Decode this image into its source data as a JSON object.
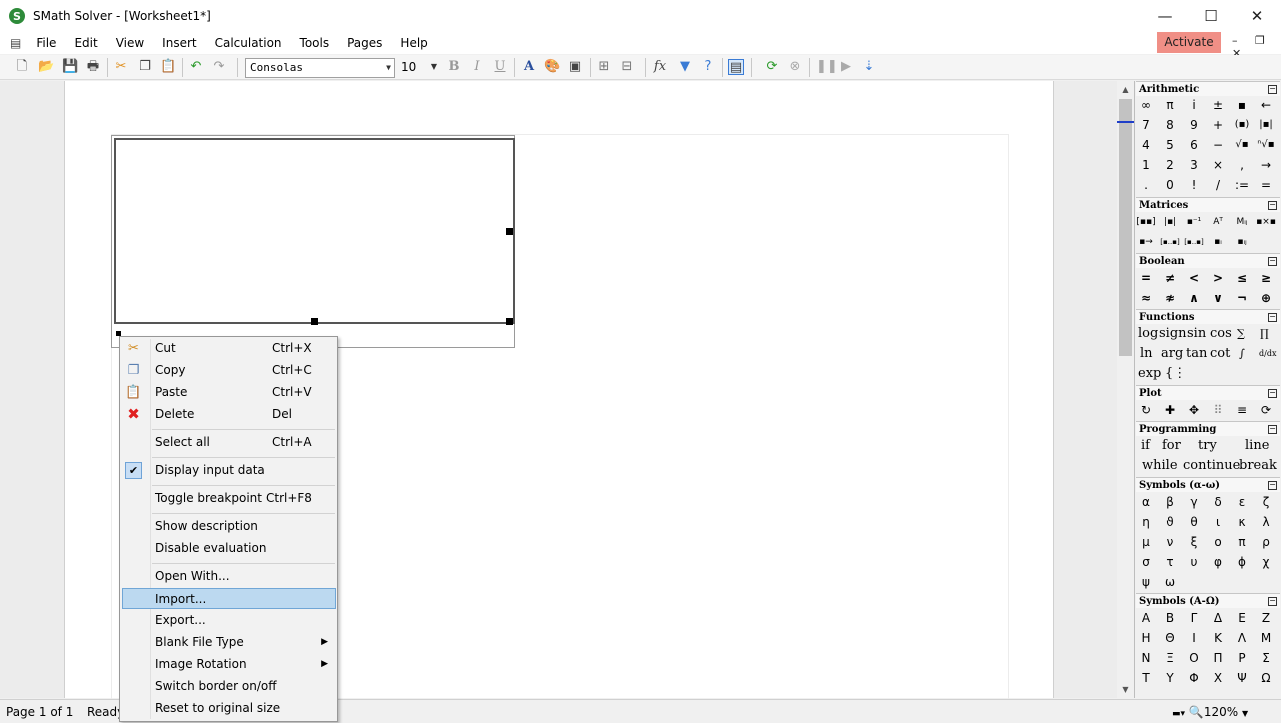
{
  "app": {
    "logo_letter": "S",
    "window_title": "SMath Solver - [Worksheet1*]",
    "window_controls": {
      "minimize": "—",
      "maximize": "☐",
      "close": "✕"
    },
    "activate_label": "Activate",
    "doc_controls": "– ❐ ✕"
  },
  "menubar": {
    "items": [
      "File",
      "Edit",
      "View",
      "Insert",
      "Calculation",
      "Tools",
      "Pages",
      "Help"
    ]
  },
  "toolbar": {
    "font_name": "Consolas",
    "font_size": "10",
    "fx_label": "fx"
  },
  "context_menu": {
    "items": [
      {
        "label": "Cut",
        "shortcut": "Ctrl+X",
        "icon": "scissors-icon"
      },
      {
        "label": "Copy",
        "shortcut": "Ctrl+C",
        "icon": "copy-icon"
      },
      {
        "label": "Paste",
        "shortcut": "Ctrl+V",
        "icon": "paste-icon"
      },
      {
        "label": "Delete",
        "shortcut": "Del",
        "icon": "delete-icon"
      },
      {
        "label": "Select all",
        "shortcut": "Ctrl+A"
      },
      {
        "label": "Display input data",
        "checked": true
      },
      {
        "label": "Toggle breakpoint",
        "shortcut": "Ctrl+F8"
      },
      {
        "label": "Show description"
      },
      {
        "label": "Disable evaluation"
      },
      {
        "label": "Open With..."
      },
      {
        "label": "Import...",
        "highlighted": true
      },
      {
        "label": "Export..."
      },
      {
        "label": "Blank File Type",
        "submenu": true
      },
      {
        "label": "Image Rotation",
        "submenu": true
      },
      {
        "label": "Switch border on/off"
      },
      {
        "label": "Reset to original size"
      }
    ]
  },
  "panels": {
    "arithmetic": {
      "title": "Arithmetic",
      "rows": [
        [
          "∞",
          "π",
          "i",
          "±",
          "▪",
          "←"
        ],
        [
          "7",
          "8",
          "9",
          "+",
          "(▪)",
          "|▪|"
        ],
        [
          "4",
          "5",
          "6",
          "−",
          "√▪",
          "ⁿ√▪"
        ],
        [
          "1",
          "2",
          "3",
          "×",
          ",",
          "→"
        ],
        [
          ".",
          "0",
          "!",
          "/",
          ":=",
          "="
        ]
      ]
    },
    "matrices": {
      "title": "Matrices",
      "rows": [
        [
          "[▪▪]",
          "|▪|",
          "▪⁻¹",
          "Aᵀ",
          "Mᵢⱼ",
          "▪×▪"
        ],
        [
          "▪→",
          "[▪..▪]",
          "[▪..▪]",
          "▪ᵢ",
          "▪ᵢⱼ"
        ]
      ]
    },
    "boolean": {
      "title": "Boolean",
      "rows": [
        [
          "=",
          "≠",
          "<",
          ">",
          "≤",
          "≥"
        ],
        [
          "≈",
          "≉",
          "∧",
          "∨",
          "¬",
          "⊕"
        ]
      ]
    },
    "functions": {
      "title": "Functions",
      "rows": [
        [
          "log",
          "sign",
          "sin",
          "cos",
          "∑",
          "∏"
        ],
        [
          "ln",
          "arg",
          "tan",
          "cot",
          "∫",
          "d/dx"
        ],
        [
          "exp",
          "{⋮"
        ]
      ]
    },
    "plot": {
      "title": "Plot",
      "rows": [
        [
          "↻",
          "✚",
          "✥",
          "⠿",
          "≡",
          "⟳"
        ]
      ]
    },
    "programming": {
      "title": "Programming",
      "rows": [
        [
          "if",
          "for",
          "try",
          "line"
        ],
        [
          "while",
          "continue",
          "break"
        ]
      ]
    },
    "greek_lower": {
      "title": "Symbols (α-ω)",
      "rows": [
        [
          "α",
          "β",
          "γ",
          "δ",
          "ε",
          "ζ"
        ],
        [
          "η",
          "ϑ",
          "θ",
          "ι",
          "κ",
          "λ"
        ],
        [
          "μ",
          "ν",
          "ξ",
          "ο",
          "π",
          "ρ"
        ],
        [
          "σ",
          "τ",
          "υ",
          "φ",
          "ϕ",
          "χ"
        ],
        [
          "ψ",
          "ω"
        ]
      ]
    },
    "greek_upper": {
      "title": "Symbols (Α-Ω)",
      "rows": [
        [
          "Α",
          "Β",
          "Γ",
          "Δ",
          "Ε",
          "Ζ"
        ],
        [
          "Η",
          "Θ",
          "Ι",
          "Κ",
          "Λ",
          "Μ"
        ],
        [
          "Ν",
          "Ξ",
          "Ο",
          "Π",
          "Ρ",
          "Σ"
        ],
        [
          "Τ",
          "Υ",
          "Φ",
          "Χ",
          "Ψ",
          "Ω"
        ]
      ]
    }
  },
  "statusbar": {
    "page": "Page 1 of 1",
    "state": "Ready",
    "zoom": "120%"
  }
}
